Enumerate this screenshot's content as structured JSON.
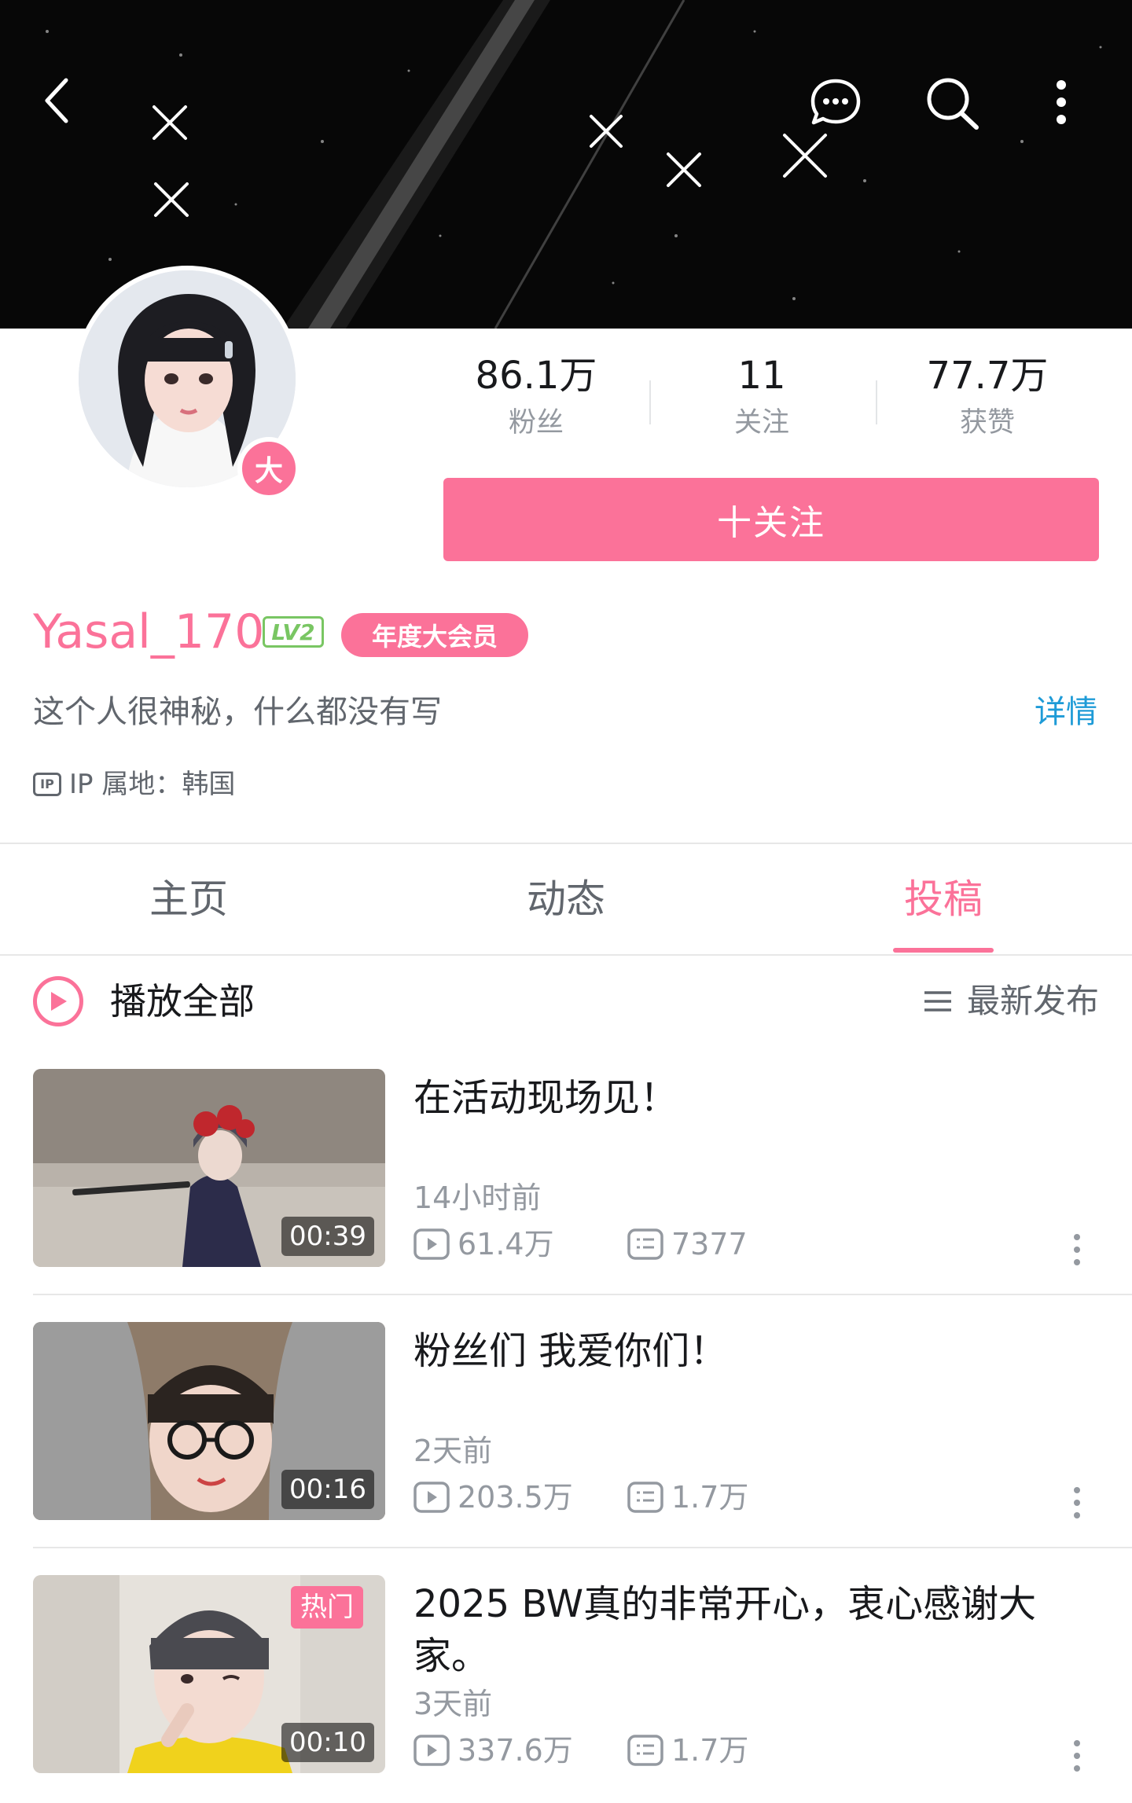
{
  "stats": {
    "fans": {
      "value": "86.1万",
      "label": "粉丝"
    },
    "following": {
      "value": "11",
      "label": "关注"
    },
    "likes": {
      "value": "77.7万",
      "label": "获赞"
    }
  },
  "follow_button": "十关注",
  "profile": {
    "avatar_badge": "大",
    "username": "Yasal_170",
    "level": "LV2",
    "vip_label": "年度大会员",
    "bio": "这个人很神秘，什么都没有写",
    "detail_link": "详情",
    "ip_icon": "IP",
    "ip_location": "IP 属地：韩国"
  },
  "tabs": [
    "主页",
    "动态",
    "投稿"
  ],
  "active_tab": "投稿",
  "list_header": {
    "play_all": "播放全部",
    "sort": "最新发布"
  },
  "videos": [
    {
      "title": "在活动现场见！",
      "time": "14小时前",
      "views": "61.4万",
      "comments": "7377",
      "duration": "00:39",
      "hot": ""
    },
    {
      "title": "粉丝们 我爱你们！",
      "time": "2天前",
      "views": "203.5万",
      "comments": "1.7万",
      "duration": "00:16",
      "hot": ""
    },
    {
      "title": "2025 BW真的非常开心，衷心感谢大家。",
      "time": "3天前",
      "views": "337.6万",
      "comments": "1.7万",
      "duration": "00:10",
      "hot": "热门"
    }
  ],
  "colors": {
    "accent": "#fb7299",
    "link": "#1e9bd7",
    "level": "#79c663"
  },
  "icons": [
    "back-icon",
    "message-icon",
    "search-icon",
    "more-icon",
    "play-icon",
    "sort-icon",
    "view-icon",
    "comment-icon"
  ]
}
